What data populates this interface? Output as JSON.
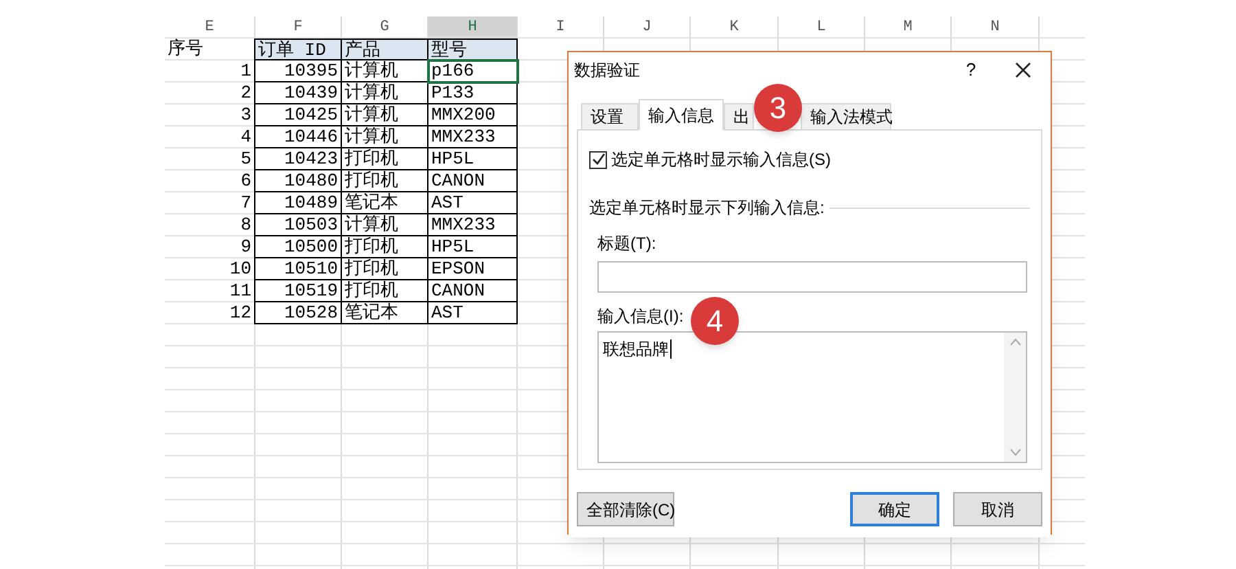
{
  "sheet": {
    "columns": [
      {
        "label": "E",
        "selected": false
      },
      {
        "label": "F",
        "selected": false
      },
      {
        "label": "G",
        "selected": false
      },
      {
        "label": "H",
        "selected": true
      },
      {
        "label": "I",
        "selected": false
      },
      {
        "label": "J",
        "selected": false
      },
      {
        "label": "K",
        "selected": false
      },
      {
        "label": "L",
        "selected": false
      },
      {
        "label": "M",
        "selected": false
      },
      {
        "label": "N",
        "selected": false
      }
    ],
    "header": [
      "序号",
      "订单 ID",
      "产品",
      "型号"
    ],
    "rows": [
      {
        "cells": [
          "1",
          "10395",
          "计算机",
          "p166"
        ],
        "selected": true
      },
      {
        "cells": [
          "2",
          "10439",
          "计算机",
          "P133"
        ],
        "selected": false
      },
      {
        "cells": [
          "3",
          "10425",
          "计算机",
          "MMX200"
        ],
        "selected": false
      },
      {
        "cells": [
          "4",
          "10446",
          "计算机",
          "MMX233"
        ],
        "selected": false
      },
      {
        "cells": [
          "5",
          "10423",
          "打印机",
          "HP5L"
        ],
        "selected": false
      },
      {
        "cells": [
          "6",
          "10480",
          "打印机",
          "CANON"
        ],
        "selected": false
      },
      {
        "cells": [
          "7",
          "10489",
          "笔记本",
          "AST"
        ],
        "selected": false
      },
      {
        "cells": [
          "8",
          "10503",
          "计算机",
          "MMX233"
        ],
        "selected": false
      },
      {
        "cells": [
          "9",
          "10500",
          "打印机",
          "HP5L"
        ],
        "selected": false
      },
      {
        "cells": [
          "10",
          "10510",
          "打印机",
          "EPSON"
        ],
        "selected": false
      },
      {
        "cells": [
          "11",
          "10519",
          "打印机",
          "CANON"
        ],
        "selected": false
      },
      {
        "cells": [
          "12",
          "10528",
          "笔记本",
          "AST"
        ],
        "selected": false
      }
    ]
  },
  "dialog": {
    "title": "数据验证",
    "help": "?",
    "tabs": [
      {
        "label": "设置",
        "selected": false
      },
      {
        "label": "输入信息",
        "selected": true
      },
      {
        "label": "出",
        "selected": false
      },
      {
        "label": "输入法模式",
        "selected": false
      }
    ],
    "checkbox": {
      "label": "选定单元格时显示输入信息(S)",
      "checked": true
    },
    "section": "选定单元格时显示下列输入信息:",
    "title_field": {
      "label": "标题(T):"
    },
    "message_field": {
      "label": "输入信息(I):",
      "value": "联想品牌"
    },
    "buttons": [
      {
        "label": "全部清除(C)",
        "default": false
      },
      {
        "label": "确定",
        "default": true
      },
      {
        "label": "取消",
        "default": false
      }
    ]
  },
  "markers": [
    "3",
    "4"
  ]
}
